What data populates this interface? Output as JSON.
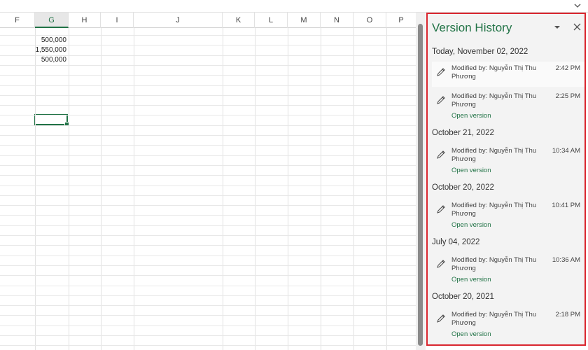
{
  "sheet": {
    "columns": [
      "F",
      "G",
      "H",
      "I",
      "J",
      "K",
      "L",
      "M",
      "N",
      "O",
      "P"
    ],
    "active_column": "G",
    "cells": [
      {
        "row": 1,
        "col": "G",
        "value": "500,000"
      },
      {
        "row": 2,
        "col": "G",
        "value": "1,550,000"
      },
      {
        "row": 3,
        "col": "G",
        "value": "500,000"
      }
    ]
  },
  "version_history": {
    "title": "Version History",
    "groups": [
      {
        "date": "Today, November 02, 2022",
        "entries": [
          {
            "modified_by": "Modified by: Nguyễn Thị Thu Phương",
            "time": "2:42 PM",
            "open": ""
          },
          {
            "modified_by": "Modified by: Nguyễn Thị Thu Phương",
            "time": "2:25 PM",
            "open": "Open version"
          }
        ]
      },
      {
        "date": "October 21, 2022",
        "entries": [
          {
            "modified_by": "Modified by: Nguyễn Thị Thu Phương",
            "time": "10:34 AM",
            "open": "Open version"
          }
        ]
      },
      {
        "date": "October 20, 2022",
        "entries": [
          {
            "modified_by": "Modified by: Nguyễn Thị Thu Phương",
            "time": "10:41 PM",
            "open": "Open version"
          }
        ]
      },
      {
        "date": "July 04, 2022",
        "entries": [
          {
            "modified_by": "Modified by: Nguyễn Thị Thu Phương",
            "time": "10:36 AM",
            "open": "Open version"
          }
        ]
      },
      {
        "date": "October 20, 2021",
        "entries": [
          {
            "modified_by": "Modified by: Nguyễn Thị Thu Phương",
            "time": "2:18 PM",
            "open": "Open version"
          }
        ]
      }
    ]
  },
  "icons": {
    "collapse": "chevron-down-icon",
    "pane_menu": "dropdown-triangle-icon",
    "pane_close": "close-icon",
    "entry": "pencil-icon"
  },
  "colors": {
    "accent": "#217346",
    "highlight_border": "#d9262e"
  }
}
